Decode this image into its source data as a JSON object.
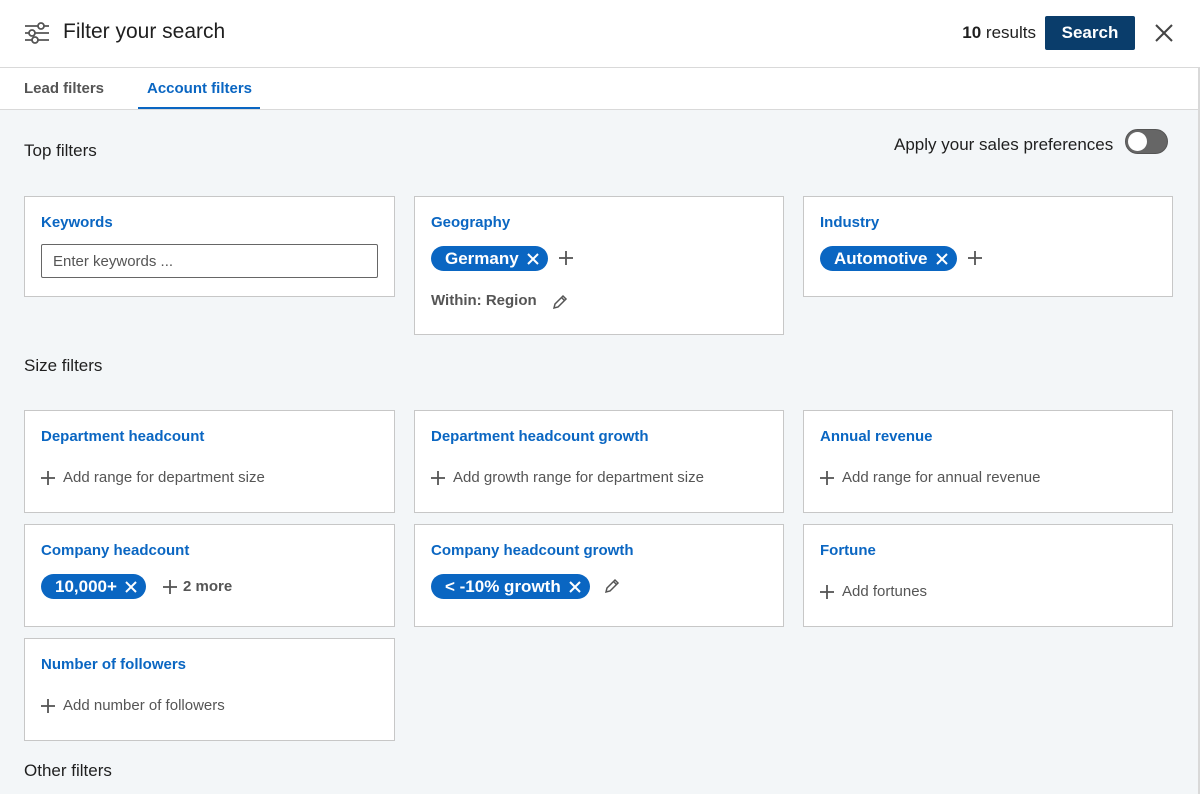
{
  "header": {
    "title": "Filter your search",
    "results_count": "10",
    "results_label": "results",
    "search_label": "Search"
  },
  "tabs": [
    {
      "label": "Lead filters",
      "active": false
    },
    {
      "label": "Account filters",
      "active": true
    }
  ],
  "sections": {
    "top": "Top filters",
    "size": "Size filters",
    "other": "Other filters"
  },
  "preferences": {
    "label": "Apply your sales preferences",
    "enabled": false
  },
  "filters": {
    "keywords": {
      "title": "Keywords",
      "placeholder": "Enter keywords ..."
    },
    "geography": {
      "title": "Geography",
      "pill": "Germany",
      "within": "Within: Region"
    },
    "industry": {
      "title": "Industry",
      "pill": "Automotive"
    },
    "department_headcount": {
      "title": "Department headcount",
      "add": "Add range for department size"
    },
    "department_headcount_growth": {
      "title": "Department headcount growth",
      "add": "Add growth range for department size"
    },
    "annual_revenue": {
      "title": "Annual revenue",
      "add": "Add range for annual revenue"
    },
    "company_headcount": {
      "title": "Company headcount",
      "pill": "10,000+",
      "more": "2 more"
    },
    "company_headcount_growth": {
      "title": "Company headcount growth",
      "pill": "< -10% growth"
    },
    "fortune": {
      "title": "Fortune",
      "add": "Add fortunes"
    },
    "followers": {
      "title": "Number of followers",
      "add": "Add number of followers"
    }
  },
  "colors": {
    "accent": "#0a66c2",
    "primary_button": "#0a3d6b",
    "background": "#f3f6f8"
  }
}
